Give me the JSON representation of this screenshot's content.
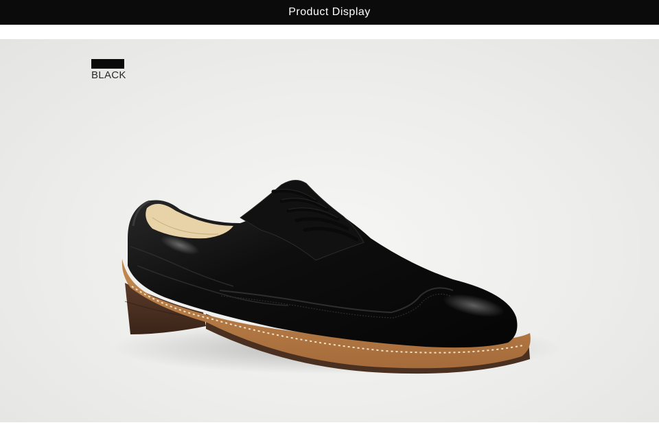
{
  "header": {
    "title": "Product Display"
  },
  "swatch": {
    "label": "BLACK",
    "color": "#0a0a0a"
  },
  "product": {
    "image": "black-leather-wingtip-derby-shoe",
    "sole_color": "#b8804a"
  }
}
